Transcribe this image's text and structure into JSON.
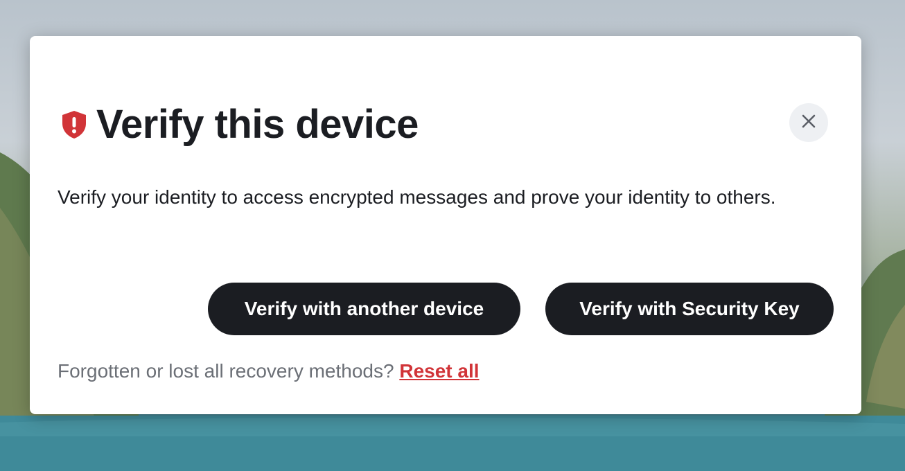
{
  "dialog": {
    "title": "Verify this device",
    "description": "Verify your identity to access encrypted messages and prove your identity to others.",
    "buttons": {
      "verify_another_device": "Verify with another device",
      "verify_security_key": "Verify with Security Key"
    },
    "footer": {
      "prompt": "Forgotten or lost all recovery methods? ",
      "reset_link": "Reset all"
    },
    "icons": {
      "title_icon": "shield-alert-icon",
      "close_icon": "close-icon"
    }
  },
  "colors": {
    "primary_button": "#1b1d22",
    "danger": "#d13438",
    "text_primary": "#1b1d22",
    "text_secondary": "#6b6f76",
    "close_bg": "#eef0f3"
  }
}
